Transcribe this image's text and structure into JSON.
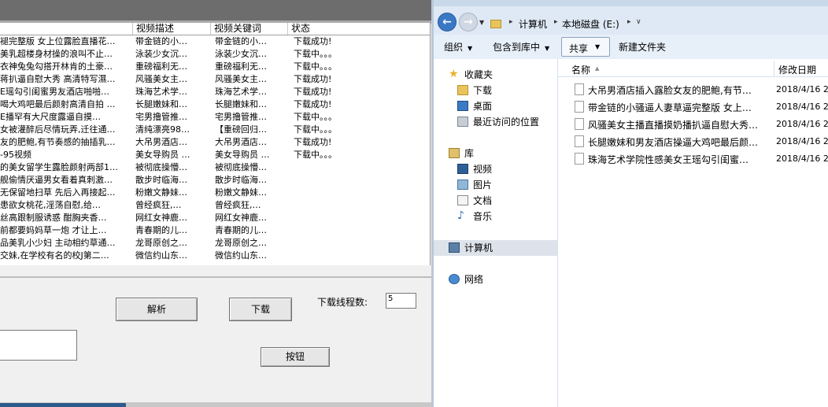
{
  "left_app": {
    "columns": {
      "video_name": "",
      "video_desc": "视频描述",
      "video_keywords": "视频关键词",
      "status": "状态"
    },
    "rows": [
      {
        "name": "褪完整版 女上位露脸直播花…",
        "desc": "带金链的小…",
        "keywords": "带金链的小…",
        "status": "下载成功!"
      },
      {
        "name": "美乳超楼身材操的浪叫不止…",
        "desc": "泳装少女沉…",
        "keywords": "泳装少女沉…",
        "status": "下载中。。。"
      },
      {
        "name": "衣神兔兔勾搭开林肯的土豪…",
        "desc": "重磅福利无…",
        "keywords": "重磅福利无…",
        "status": "下载中。。。"
      },
      {
        "name": "蒋扒逼自慰大秀 高清特写濕…",
        "desc": "风骚美女主…",
        "keywords": "风骚美女主…",
        "status": "下载成功!"
      },
      {
        "name": "E瑶勾引闺蜜男友酒店啪啪…",
        "desc": "珠海艺术学…",
        "keywords": "珠海艺术学…",
        "status": "下载成功!"
      },
      {
        "name": "喝大鸡吧最后颜射高清自拍 …",
        "desc": "长腿嫩妹和…",
        "keywords": "长腿嫩妹和…",
        "status": "下载成功!"
      },
      {
        "name": "E播罕有大尺度露逼自摸…",
        "desc": "宅男撸管推…",
        "keywords": "宅男撸管推…",
        "status": "下载中。。。"
      },
      {
        "name": "女被灌醉后尽情玩弄,迁往通…",
        "desc": "清纯漂亮98…",
        "keywords": "【重磅回归…",
        "status": "下载中。。。"
      },
      {
        "name": "友的肥鲍,有节奏感的抽插乳…",
        "desc": "大吊男酒店…",
        "keywords": "大吊男酒店…",
        "status": "下载成功!"
      },
      {
        "name": "-95视频",
        "desc": "美女导购员 …",
        "keywords": "美女导购员 …",
        "status": "下载中。。。"
      },
      {
        "name": "的美女留学生露脸颜射两部1…",
        "desc": "被彻底操懵…",
        "keywords": "被彻底操懵…",
        "status": ""
      },
      {
        "name": "舰偷情厌逼男女看着真刺激…",
        "desc": "散步时临海…",
        "keywords": "散步时临海…",
        "status": ""
      },
      {
        "name": "无保留地扫草 先后入再接起…",
        "desc": "粉嫩文静妹…",
        "keywords": "粉嫩文静妹…",
        "status": ""
      },
      {
        "name": "患欲女桃花,淫荡自慰,给…",
        "desc": "曾经疯狂,…",
        "keywords": "曾经疯狂,…",
        "status": ""
      },
      {
        "name": "丝高跟制服诱惑 酣胸夹香…",
        "desc": "网红女神鹿…",
        "keywords": "网红女神鹿…",
        "status": ""
      },
      {
        "name": "前都要妈妈草一炮 才让上…",
        "desc": "青春期的儿…",
        "keywords": "青春期的儿…",
        "status": ""
      },
      {
        "name": "品美乳小少妇 主动相约草通…",
        "desc": "龙哥原创之…",
        "keywords": "龙哥原创之…",
        "status": ""
      },
      {
        "name": "交妹,在学校有名的校J第二…",
        "desc": "微信约山东…",
        "keywords": "微信约山东…",
        "status": ""
      },
      {
        "name": "",
        "desc": "",
        "keywords": "",
        "status": ""
      }
    ],
    "buttons": {
      "parse": "解析",
      "download": "下载",
      "button": "按钮"
    },
    "thread_label": "下载线程数:",
    "thread_count": "5"
  },
  "explorer": {
    "breadcrumb": [
      "计算机",
      "本地磁盘 (E:)"
    ],
    "toolbar": {
      "organize": "组织",
      "include_library": "包含到库中",
      "share": "共享",
      "new_folder": "新建文件夹"
    },
    "nav": {
      "favorites": "收藏夹",
      "downloads": "下载",
      "desktop": "桌面",
      "recent": "最近访问的位置",
      "libraries": "库",
      "videos": "视频",
      "pictures": "图片",
      "documents": "文档",
      "music": "音乐",
      "computer": "计算机",
      "network": "网络"
    },
    "columns": {
      "name": "名称",
      "modified": "修改日期"
    },
    "files": [
      {
        "name": "大吊男酒店插入露脸女友的肥鲍,有节…",
        "date": "2018/4/16 2"
      },
      {
        "name": "带金链的小骚逼人妻草逼完整版 女上…",
        "date": "2018/4/16 2"
      },
      {
        "name": "风骚美女主播直播摸奶播扒逼自慰大秀…",
        "date": "2018/4/16 2"
      },
      {
        "name": "长腿嫩妹和男友酒店操逼大鸡吧最后颜…",
        "date": "2018/4/16 2"
      },
      {
        "name": "珠海艺术学院性感美女王瑶勾引闺蜜…",
        "date": "2018/4/16 2"
      }
    ]
  }
}
